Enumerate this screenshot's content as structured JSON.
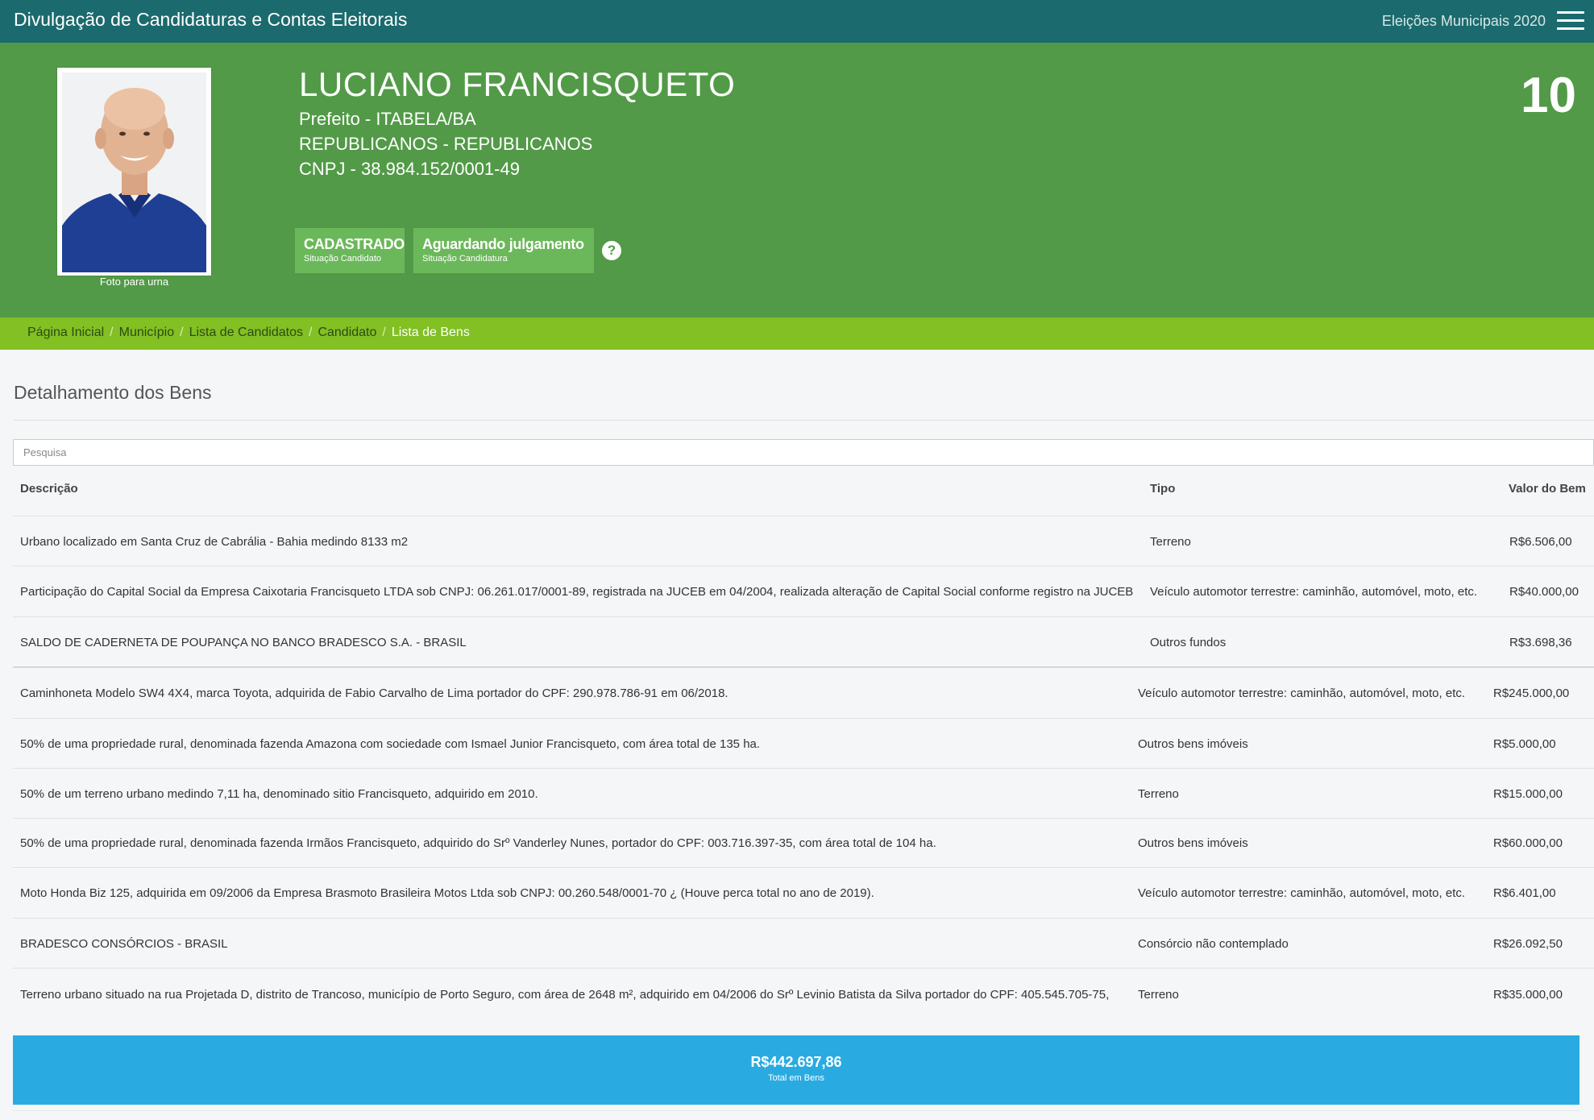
{
  "topbar": {
    "title": "Divulgação de Candidaturas e Contas Eleitorais",
    "election": "Eleições Municipais 2020"
  },
  "candidate": {
    "name": "LUCIANO FRANCISQUETO",
    "office": "Prefeito - ITABELA/BA",
    "party": "REPUBLICANOS - REPUBLICANOS",
    "cnpj": "CNPJ - 38.984.152/0001-49",
    "number": "10",
    "photo_caption": "Foto para urna"
  },
  "badges": [
    {
      "main": "CADASTRADO",
      "sub": "Situação Candidato"
    },
    {
      "main": "Aguardando julgamento",
      "sub": "Situação Candidatura"
    }
  ],
  "breadcrumb": {
    "items": [
      "Página Inicial",
      "Município",
      "Lista de Candidatos",
      "Candidato"
    ],
    "current": "Lista de Bens",
    "separator": "/"
  },
  "section": {
    "title": "Detalhamento dos Bens",
    "search_placeholder": "Pesquisa"
  },
  "table": {
    "headers": {
      "description": "Descrição",
      "type": "Tipo",
      "value": "Valor do Bem"
    },
    "rows": [
      {
        "description": "Urbano localizado em Santa Cruz de Cabrália - Bahia medindo 8133 m2",
        "type": "Terreno",
        "value": "R$6.506,00"
      },
      {
        "description": "Participação do Capital Social da Empresa Caixotaria Francisqueto LTDA sob CNPJ: 06.261.017/0001-89, registrada na JUCEB em 04/2004, realizada alteração de Capital Social conforme registro na JUCEB",
        "type": "Veículo automotor terrestre: caminhão, automóvel, moto, etc.",
        "value": "R$40.000,00"
      },
      {
        "description": "SALDO DE CADERNETA DE POUPANÇA NO BANCO BRADESCO S.A. - BRASIL",
        "type": "Outros fundos",
        "value": "R$3.698,36"
      },
      {
        "description": "Caminhoneta Modelo SW4 4X4, marca Toyota, adquirida de Fabio Carvalho de Lima portador do CPF: 290.978.786-91 em 06/2018.",
        "type": "Veículo automotor terrestre: caminhão, automóvel, moto, etc.",
        "value": "R$245.000,00"
      },
      {
        "description": "50% de uma propriedade rural, denominada fazenda Amazona com sociedade com Ismael Junior Francisqueto, com área total de 135 ha.",
        "type": "Outros bens imóveis",
        "value": "R$5.000,00"
      },
      {
        "description": "50% de um terreno urbano medindo 7,11 ha, denominado sitio Francisqueto, adquirido em 2010.",
        "type": "Terreno",
        "value": "R$15.000,00"
      },
      {
        "description": "50% de uma propriedade rural, denominada fazenda Irmãos Francisqueto, adquirido do Srº Vanderley Nunes, portador do CPF: 003.716.397-35, com área total de 104 ha.",
        "type": "Outros bens imóveis",
        "value": "R$60.000,00"
      },
      {
        "description": "Moto Honda Biz 125, adquirida em 09/2006 da Empresa Brasmoto Brasileira Motos Ltda sob CNPJ: 00.260.548/0001-70 ¿ (Houve perca total no ano de 2019).",
        "type": "Veículo automotor terrestre: caminhão, automóvel, moto, etc.",
        "value": "R$6.401,00"
      },
      {
        "description": "BRADESCO CONSÓRCIOS - BRASIL",
        "type": "Consórcio não contemplado",
        "value": "R$26.092,50"
      },
      {
        "description": "Terreno urbano situado na rua Projetada D, distrito de Trancoso, município de Porto Seguro, com área de 2648 m², adquirido em 04/2006 do Srº Levinio Batista da Silva portador do CPF: 405.545.705-75,",
        "type": "Terreno",
        "value": "R$35.000,00"
      }
    ]
  },
  "total": {
    "value": "R$442.697,86",
    "label": "Total em Bens"
  },
  "colors": {
    "topbar": "#1b6a6e",
    "header": "#529a47",
    "badge": "#6bb85a",
    "breadcrumb": "#82c023",
    "total": "#29abe2"
  }
}
